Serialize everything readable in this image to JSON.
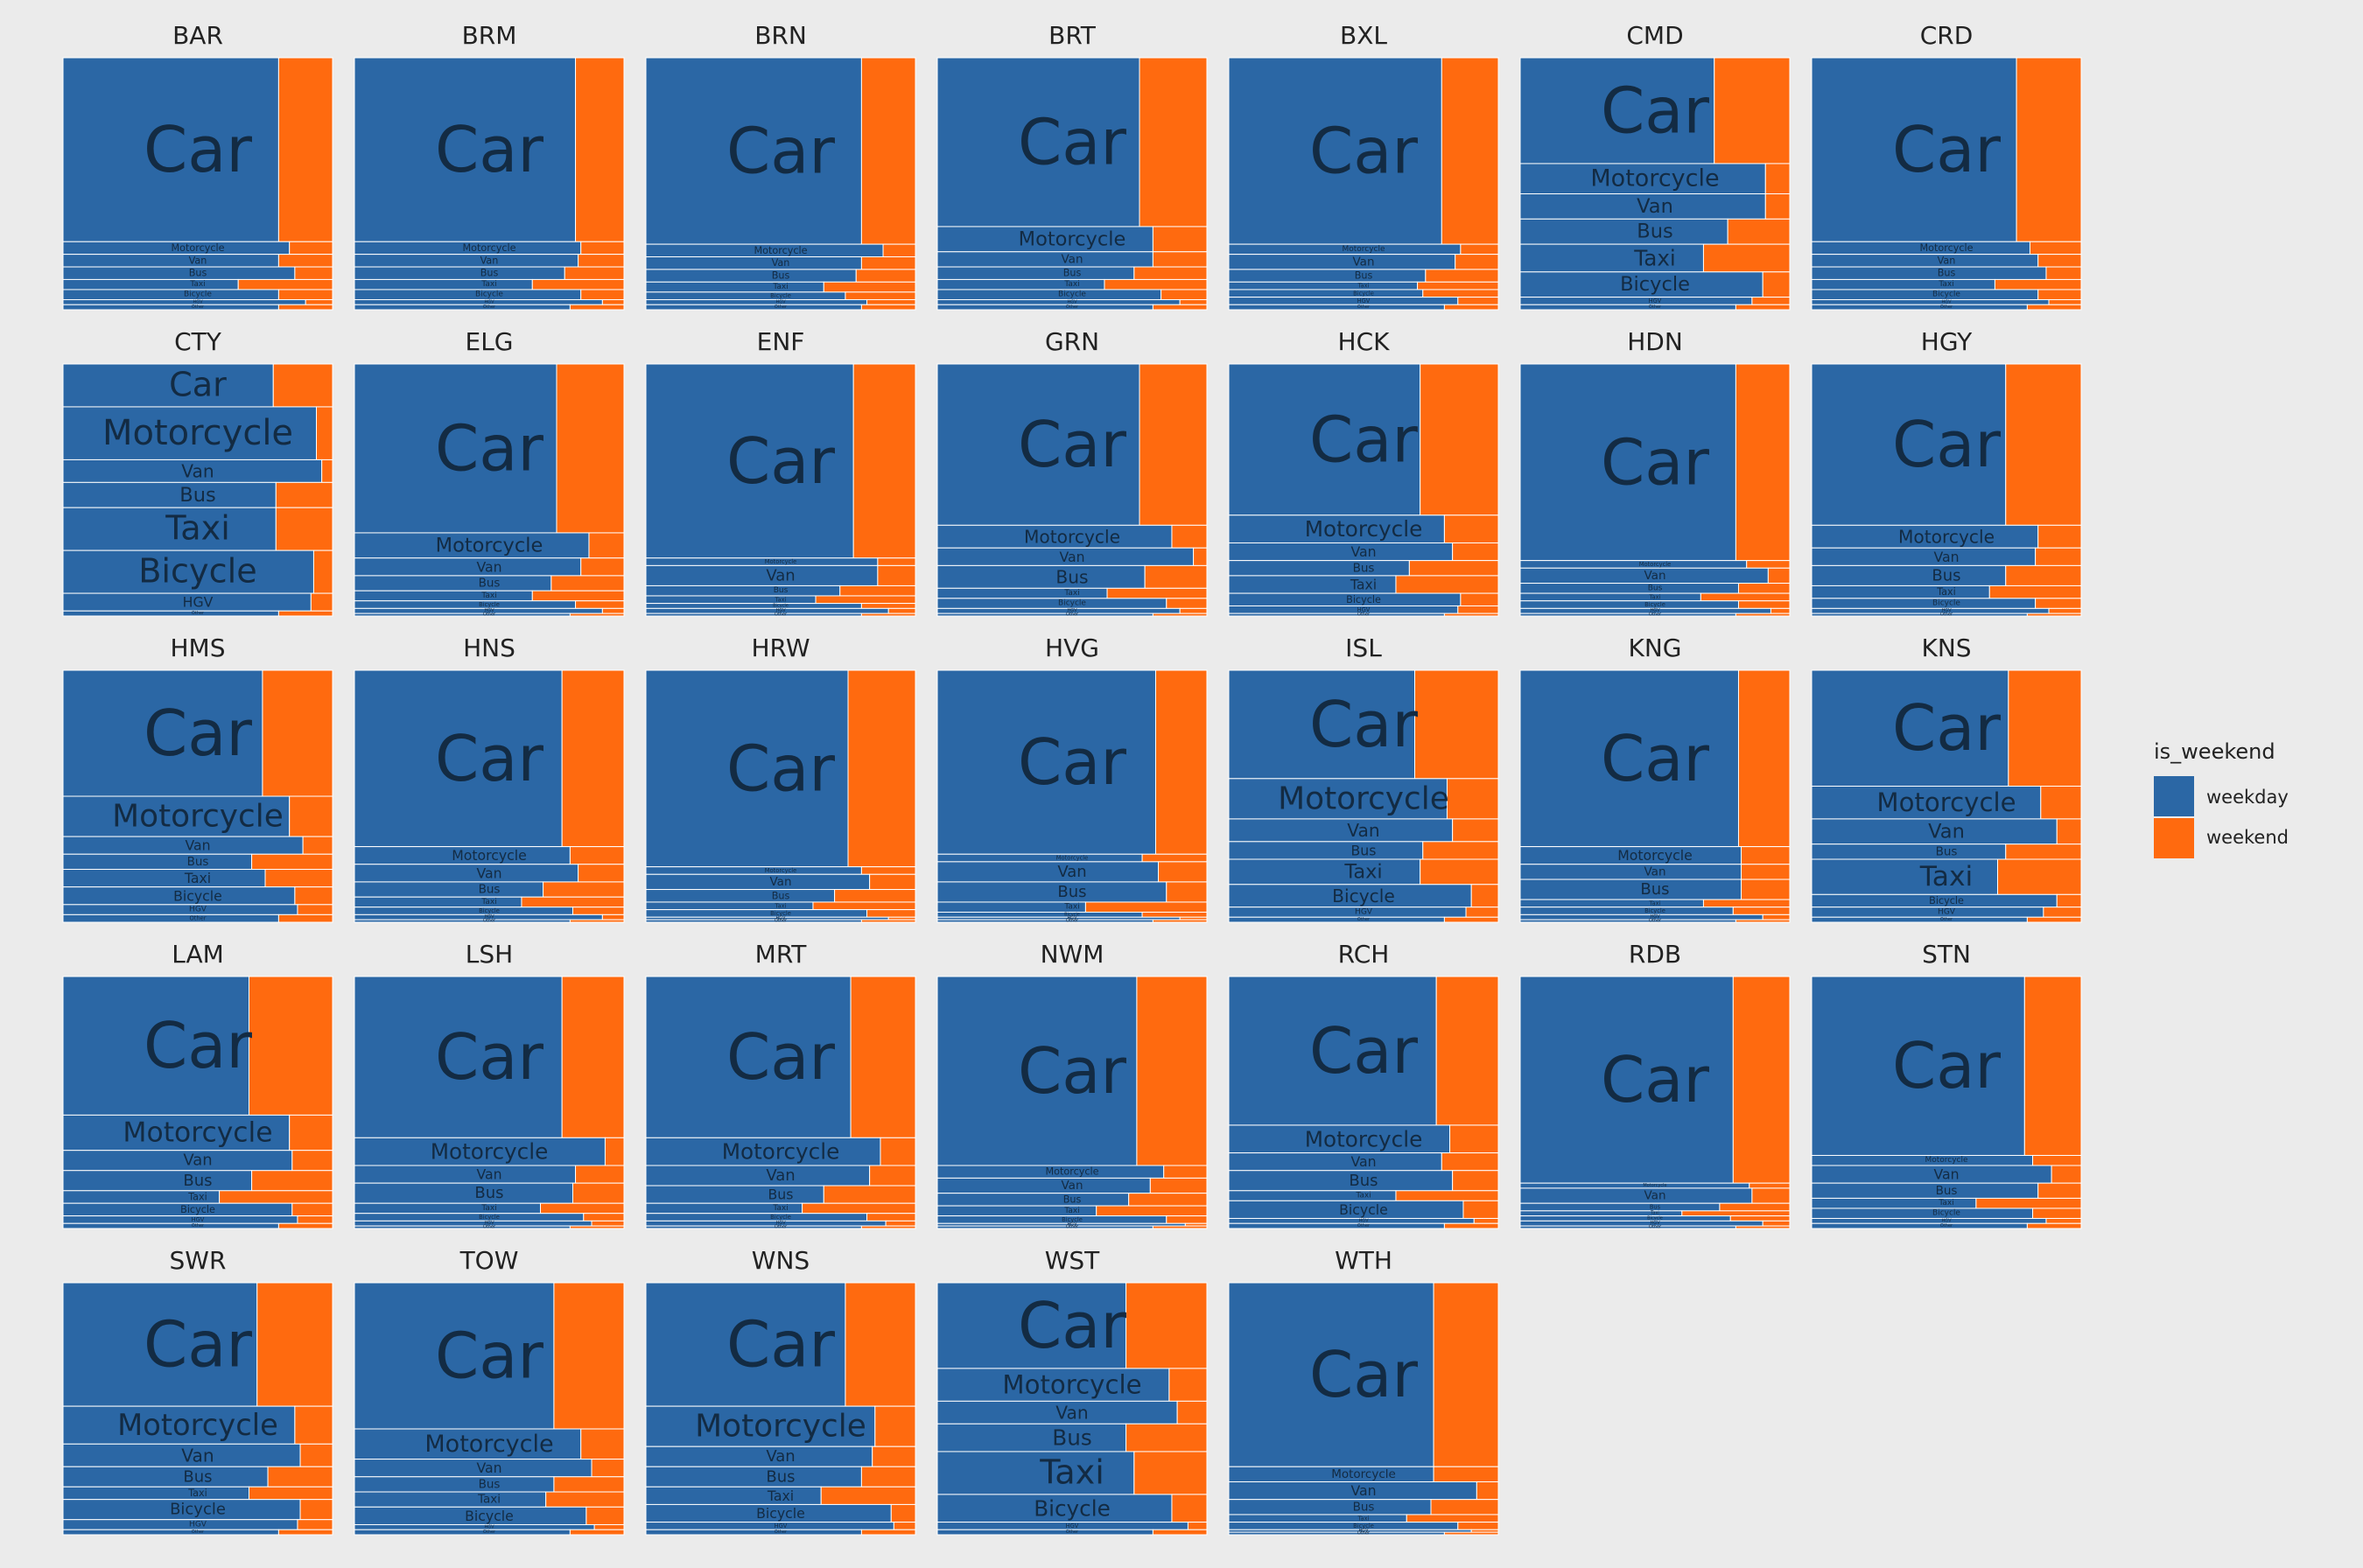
{
  "colors": {
    "weekday": "#2b67a5",
    "weekend": "#ff6a0f",
    "panel": "#ebebeb",
    "grid": "#d2d2d2",
    "text": "#132b43"
  },
  "legend": {
    "title": "is_weekend",
    "items": [
      {
        "label": "weekday",
        "color": "#2b67a5"
      },
      {
        "label": "weekend",
        "color": "#ff6a0f"
      }
    ]
  },
  "chart_data": {
    "type": "mosaic",
    "facet_variable": "borough",
    "fill_variable": "is_weekend",
    "categories": [
      "Car",
      "Motorcycle",
      "Van",
      "Bus",
      "Taxi",
      "Bicycle",
      "HGV",
      "Other"
    ],
    "panels": [
      {
        "name": "BAR",
        "h": [
          0.73,
          0.05,
          0.05,
          0.05,
          0.04,
          0.04,
          0.02,
          0.02
        ],
        "w": [
          0.8,
          0.84,
          0.8,
          0.86,
          0.65,
          0.8,
          0.9,
          0.8
        ]
      },
      {
        "name": "BRM",
        "h": [
          0.73,
          0.05,
          0.05,
          0.05,
          0.04,
          0.04,
          0.02,
          0.02
        ],
        "w": [
          0.82,
          0.84,
          0.83,
          0.78,
          0.66,
          0.84,
          0.92,
          0.8
        ]
      },
      {
        "name": "BRN",
        "h": [
          0.74,
          0.05,
          0.05,
          0.05,
          0.04,
          0.03,
          0.02,
          0.02
        ],
        "w": [
          0.8,
          0.88,
          0.8,
          0.78,
          0.66,
          0.74,
          0.82,
          0.8
        ]
      },
      {
        "name": "BRT",
        "h": [
          0.67,
          0.1,
          0.06,
          0.05,
          0.04,
          0.04,
          0.02,
          0.02
        ],
        "w": [
          0.75,
          0.8,
          0.8,
          0.73,
          0.62,
          0.83,
          0.9,
          0.8
        ]
      },
      {
        "name": "BXL",
        "h": [
          0.74,
          0.04,
          0.06,
          0.05,
          0.03,
          0.03,
          0.03,
          0.02
        ],
        "w": [
          0.79,
          0.86,
          0.84,
          0.73,
          0.7,
          0.72,
          0.85,
          0.8
        ]
      },
      {
        "name": "CMD",
        "h": [
          0.42,
          0.12,
          0.1,
          0.1,
          0.11,
          0.1,
          0.03,
          0.02
        ],
        "w": [
          0.72,
          0.91,
          0.91,
          0.77,
          0.68,
          0.9,
          0.86,
          0.8
        ]
      },
      {
        "name": "CRD",
        "h": [
          0.73,
          0.05,
          0.05,
          0.05,
          0.04,
          0.04,
          0.02,
          0.02
        ],
        "w": [
          0.76,
          0.81,
          0.84,
          0.87,
          0.68,
          0.84,
          0.88,
          0.8
        ]
      },
      {
        "name": "CTY",
        "h": [
          0.17,
          0.21,
          0.09,
          0.1,
          0.17,
          0.17,
          0.07,
          0.02
        ],
        "w": [
          0.78,
          0.94,
          0.96,
          0.79,
          0.79,
          0.93,
          0.92,
          0.8
        ]
      },
      {
        "name": "ELG",
        "h": [
          0.67,
          0.1,
          0.07,
          0.06,
          0.04,
          0.03,
          0.02,
          0.01
        ],
        "w": [
          0.75,
          0.87,
          0.84,
          0.73,
          0.66,
          0.82,
          0.92,
          0.8
        ]
      },
      {
        "name": "ENF",
        "h": [
          0.77,
          0.03,
          0.08,
          0.04,
          0.03,
          0.02,
          0.02,
          0.01
        ],
        "w": [
          0.77,
          0.86,
          0.86,
          0.72,
          0.63,
          0.8,
          0.9,
          0.8
        ]
      },
      {
        "name": "GRN",
        "h": [
          0.64,
          0.09,
          0.07,
          0.09,
          0.04,
          0.04,
          0.02,
          0.01
        ],
        "w": [
          0.75,
          0.87,
          0.95,
          0.77,
          0.63,
          0.85,
          0.9,
          0.8
        ]
      },
      {
        "name": "HCK",
        "h": [
          0.6,
          0.11,
          0.07,
          0.06,
          0.07,
          0.05,
          0.03,
          0.01
        ],
        "w": [
          0.71,
          0.8,
          0.83,
          0.67,
          0.62,
          0.86,
          0.85,
          0.8
        ]
      },
      {
        "name": "HDN",
        "h": [
          0.78,
          0.03,
          0.06,
          0.04,
          0.03,
          0.03,
          0.02,
          0.01
        ],
        "w": [
          0.8,
          0.84,
          0.92,
          0.81,
          0.67,
          0.81,
          0.93,
          0.8
        ]
      },
      {
        "name": "HGY",
        "h": [
          0.64,
          0.09,
          0.07,
          0.08,
          0.05,
          0.04,
          0.02,
          0.01
        ],
        "w": [
          0.72,
          0.84,
          0.83,
          0.72,
          0.66,
          0.83,
          0.88,
          0.8
        ]
      },
      {
        "name": "HMS",
        "h": [
          0.5,
          0.16,
          0.07,
          0.06,
          0.07,
          0.07,
          0.04,
          0.03
        ],
        "w": [
          0.74,
          0.84,
          0.89,
          0.7,
          0.75,
          0.86,
          0.87,
          0.8
        ]
      },
      {
        "name": "HNS",
        "h": [
          0.7,
          0.07,
          0.07,
          0.06,
          0.04,
          0.03,
          0.02,
          0.01
        ],
        "w": [
          0.77,
          0.8,
          0.83,
          0.7,
          0.62,
          0.81,
          0.92,
          0.8
        ]
      },
      {
        "name": "HRW",
        "h": [
          0.78,
          0.03,
          0.06,
          0.05,
          0.03,
          0.03,
          0.01,
          0.01
        ],
        "w": [
          0.75,
          0.8,
          0.83,
          0.7,
          0.62,
          0.82,
          0.9,
          0.8
        ]
      },
      {
        "name": "HVG",
        "h": [
          0.73,
          0.03,
          0.08,
          0.08,
          0.04,
          0.02,
          0.01,
          0.01
        ],
        "w": [
          0.81,
          0.76,
          0.82,
          0.85,
          0.55,
          0.76,
          0.9,
          0.8
        ]
      },
      {
        "name": "ISL",
        "h": [
          0.43,
          0.16,
          0.09,
          0.07,
          0.1,
          0.09,
          0.04,
          0.02
        ],
        "w": [
          0.69,
          0.81,
          0.83,
          0.72,
          0.71,
          0.9,
          0.88,
          0.8
        ]
      },
      {
        "name": "KNG",
        "h": [
          0.7,
          0.07,
          0.06,
          0.08,
          0.03,
          0.03,
          0.02,
          0.01
        ],
        "w": [
          0.81,
          0.82,
          0.82,
          0.82,
          0.68,
          0.79,
          0.9,
          0.8
        ]
      },
      {
        "name": "KNS",
        "h": [
          0.46,
          0.13,
          0.1,
          0.06,
          0.14,
          0.05,
          0.04,
          0.02
        ],
        "w": [
          0.73,
          0.85,
          0.91,
          0.72,
          0.69,
          0.91,
          0.86,
          0.8
        ]
      },
      {
        "name": "LAM",
        "h": [
          0.55,
          0.14,
          0.08,
          0.08,
          0.05,
          0.05,
          0.03,
          0.02
        ],
        "w": [
          0.69,
          0.84,
          0.85,
          0.7,
          0.58,
          0.85,
          0.87,
          0.8
        ]
      },
      {
        "name": "LSH",
        "h": [
          0.64,
          0.11,
          0.07,
          0.08,
          0.04,
          0.03,
          0.02,
          0.01
        ],
        "w": [
          0.77,
          0.93,
          0.82,
          0.81,
          0.69,
          0.85,
          0.88,
          0.8
        ]
      },
      {
        "name": "MRT",
        "h": [
          0.64,
          0.11,
          0.08,
          0.07,
          0.04,
          0.03,
          0.02,
          0.01
        ],
        "w": [
          0.76,
          0.87,
          0.83,
          0.66,
          0.58,
          0.82,
          0.89,
          0.8
        ]
      },
      {
        "name": "NWM",
        "h": [
          0.75,
          0.05,
          0.06,
          0.05,
          0.04,
          0.03,
          0.01,
          0.01
        ],
        "w": [
          0.74,
          0.84,
          0.79,
          0.71,
          0.59,
          0.85,
          0.92,
          0.8
        ]
      },
      {
        "name": "RCH",
        "h": [
          0.59,
          0.11,
          0.07,
          0.08,
          0.04,
          0.07,
          0.02,
          0.02
        ],
        "w": [
          0.77,
          0.82,
          0.79,
          0.83,
          0.62,
          0.87,
          0.91,
          0.8
        ]
      },
      {
        "name": "RDB",
        "h": [
          0.82,
          0.02,
          0.06,
          0.03,
          0.02,
          0.02,
          0.02,
          0.01
        ],
        "w": [
          0.79,
          0.85,
          0.86,
          0.74,
          0.6,
          0.78,
          0.9,
          0.8
        ]
      },
      {
        "name": "STN",
        "h": [
          0.71,
          0.04,
          0.07,
          0.06,
          0.04,
          0.04,
          0.02,
          0.02
        ],
        "w": [
          0.79,
          0.82,
          0.89,
          0.84,
          0.61,
          0.82,
          0.87,
          0.8
        ]
      },
      {
        "name": "SWR",
        "h": [
          0.49,
          0.15,
          0.09,
          0.08,
          0.05,
          0.08,
          0.04,
          0.02
        ],
        "w": [
          0.72,
          0.86,
          0.88,
          0.76,
          0.69,
          0.88,
          0.87,
          0.8
        ]
      },
      {
        "name": "TOW",
        "h": [
          0.58,
          0.12,
          0.07,
          0.06,
          0.06,
          0.07,
          0.02,
          0.02
        ],
        "w": [
          0.74,
          0.84,
          0.88,
          0.74,
          0.71,
          0.86,
          0.89,
          0.8
        ]
      },
      {
        "name": "WNS",
        "h": [
          0.49,
          0.16,
          0.08,
          0.08,
          0.07,
          0.07,
          0.03,
          0.02
        ],
        "w": [
          0.74,
          0.85,
          0.84,
          0.8,
          0.65,
          0.91,
          0.92,
          0.8
        ]
      },
      {
        "name": "WST",
        "h": [
          0.34,
          0.13,
          0.09,
          0.11,
          0.17,
          0.11,
          0.03,
          0.02
        ],
        "w": [
          0.7,
          0.86,
          0.89,
          0.7,
          0.73,
          0.87,
          0.93,
          0.8
        ]
      },
      {
        "name": "WTH",
        "h": [
          0.73,
          0.06,
          0.07,
          0.06,
          0.03,
          0.03,
          0.01,
          0.01
        ],
        "w": [
          0.76,
          0.76,
          0.92,
          0.75,
          0.66,
          0.85,
          0.9,
          0.8
        ]
      }
    ]
  }
}
